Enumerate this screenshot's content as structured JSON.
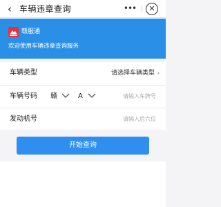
{
  "navbar": {
    "back_icon": "chevron-left-icon",
    "title": "车辆违章查询",
    "more_icon": "more-dots-icon",
    "more_glyph": "•••",
    "close_icon": "close-circle-icon",
    "close_glyph": "✕"
  },
  "banner": {
    "background_color": "#2a8fe6",
    "brand_logo_icon": "mountain-logo-icon",
    "brand_logo_color": "#e8303c",
    "brand_name": "赣服通",
    "welcome_text": "欢迎使用车辆违章查询服务"
  },
  "form": {
    "vehicle_type": {
      "label": "车辆类型",
      "value": "请选择车辆类型"
    },
    "plate": {
      "label": "车辆号码",
      "province": "赣",
      "letter": "A",
      "placeholder": "请输入车牌号"
    },
    "engine": {
      "label": "发动机号",
      "placeholder": "请输入后六位"
    }
  },
  "submit": {
    "label": "开始查询",
    "color": "#2f8ff0"
  }
}
